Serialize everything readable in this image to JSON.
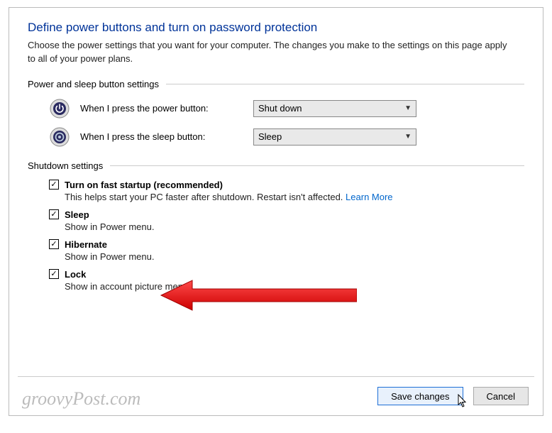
{
  "title": "Define power buttons and turn on password protection",
  "intro": "Choose the power settings that you want for your computer. The changes you make to the settings on this page apply to all of your power plans.",
  "sections": {
    "buttons_header": "Power and sleep button settings",
    "shutdown_header": "Shutdown settings"
  },
  "power_button": {
    "label": "When I press the power button:",
    "value": "Shut down"
  },
  "sleep_button": {
    "label": "When I press the sleep button:",
    "value": "Sleep"
  },
  "shutdown_items": [
    {
      "title": "Turn on fast startup (recommended)",
      "desc": "This helps start your PC faster after shutdown. Restart isn't affected.",
      "link": "Learn More",
      "checked": true
    },
    {
      "title": "Sleep",
      "desc": "Show in Power menu.",
      "checked": true
    },
    {
      "title": "Hibernate",
      "desc": "Show in Power menu.",
      "checked": true
    },
    {
      "title": "Lock",
      "desc": "Show in account picture menu.",
      "checked": true
    }
  ],
  "footer": {
    "save": "Save changes",
    "cancel": "Cancel"
  },
  "watermark": "groovyPost.com"
}
